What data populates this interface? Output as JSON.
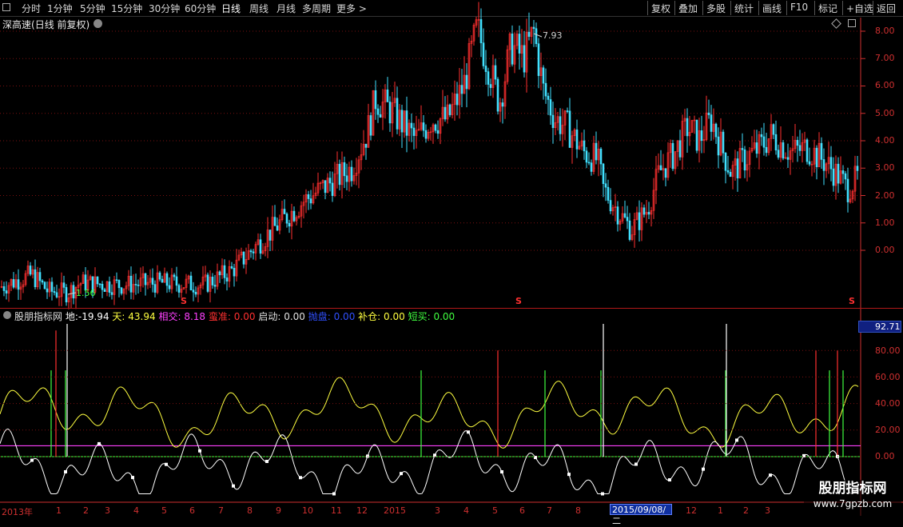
{
  "toolbar": {
    "periods": [
      "分时",
      "1分钟",
      "5分钟",
      "15分钟",
      "30分钟",
      "60分钟",
      "日线",
      "周线",
      "月线",
      "多周期",
      "更多 >"
    ],
    "active_period": "日线",
    "right_buttons": [
      "复权",
      "叠加",
      "多股",
      "统计",
      "画线",
      "F10",
      "标记",
      "+自选",
      "返回"
    ]
  },
  "main_chart": {
    "title": "深高速",
    "subtitle": "(日线 前复权)",
    "y_ticks": [
      "8.00",
      "7.00",
      "6.00",
      "5.00",
      "4.00",
      "3.00",
      "2.00",
      "1.00",
      "0.00"
    ],
    "high_marker": "7.93",
    "low_marker": "1.56",
    "s_marker": "S"
  },
  "indicator": {
    "name": "股朋指标网",
    "items": [
      {
        "label": "地:",
        "value": "-19.94"
      },
      {
        "label": "天:",
        "value": "43.94"
      },
      {
        "label": "相交:",
        "value": "8.18"
      },
      {
        "label": "蛮准:",
        "value": "0.00"
      },
      {
        "label": "启动:",
        "value": "0.00"
      },
      {
        "label": "抛盘:",
        "value": "0.00"
      },
      {
        "label": "补仓:",
        "value": "0.00"
      },
      {
        "label": "短买:",
        "value": "0.00"
      }
    ],
    "y_ticks": [
      "80.00",
      "60.00",
      "40.00",
      "20.00",
      "0.00"
    ],
    "current_value": "92.71"
  },
  "time_axis": {
    "months": [
      "2013年",
      "1",
      "2",
      "3",
      "4",
      "5",
      "6",
      "7",
      "8",
      "9",
      "10",
      "11",
      "12",
      "2015",
      "3",
      "4",
      "5",
      "6",
      "7",
      "8",
      "2015/09/08/二",
      "12",
      "1",
      "2",
      "3"
    ],
    "cursor_date": "2015/09/08/二"
  },
  "watermark": {
    "line1": "股朋指标网",
    "line2": "www.7gpzb.com"
  },
  "colors": {
    "up": "#ff3030",
    "down": "#40e0ff",
    "axis": "#d03030",
    "yellow_line": "#ffff40",
    "white_line": "#ffffff",
    "magenta_line": "#ff40ff",
    "green_line": "#40ff40"
  }
}
